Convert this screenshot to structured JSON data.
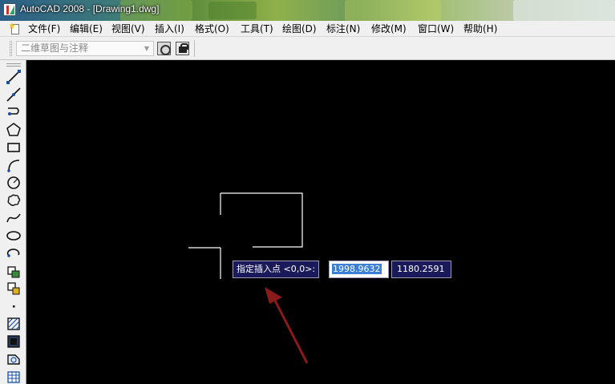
{
  "window": {
    "title": "AutoCAD 2008 - [Drawing1.dwg]"
  },
  "menu": {
    "items": [
      {
        "label": "文件(F)"
      },
      {
        "label": "编辑(E)"
      },
      {
        "label": "视图(V)"
      },
      {
        "label": "插入(I)"
      },
      {
        "label": "格式(O)"
      },
      {
        "label": "工具(T)"
      },
      {
        "label": "绘图(D)"
      },
      {
        "label": "标注(N)"
      },
      {
        "label": "修改(M)"
      },
      {
        "label": "窗口(W)"
      },
      {
        "label": "帮助(H)"
      }
    ]
  },
  "toolbar": {
    "workspace_value": "二维草图与注释",
    "icons": [
      "workspace-settings-icon",
      "workspace-lock-icon"
    ]
  },
  "draw_toolbar": {
    "tools": [
      "line-icon",
      "construction-line-icon",
      "polyline-icon",
      "polygon-icon",
      "rectangle-icon",
      "arc-icon",
      "circle-icon",
      "revision-cloud-icon",
      "spline-icon",
      "ellipse-icon",
      "ellipse-arc-icon",
      "insert-block-icon",
      "make-block-icon",
      "point-icon",
      "hatch-icon",
      "gradient-icon",
      "region-icon",
      "table-icon"
    ]
  },
  "dynamic_input": {
    "prompt": "指定插入点 <0,0>:",
    "x_value": "1998.9632",
    "y_value": "1180.2591"
  },
  "colors": {
    "canvas_background": "#000000",
    "prompt_background": "#1a1a5a",
    "annotation_arrow": "#8b1a1a",
    "selection_highlight": "#3b7fd6"
  }
}
